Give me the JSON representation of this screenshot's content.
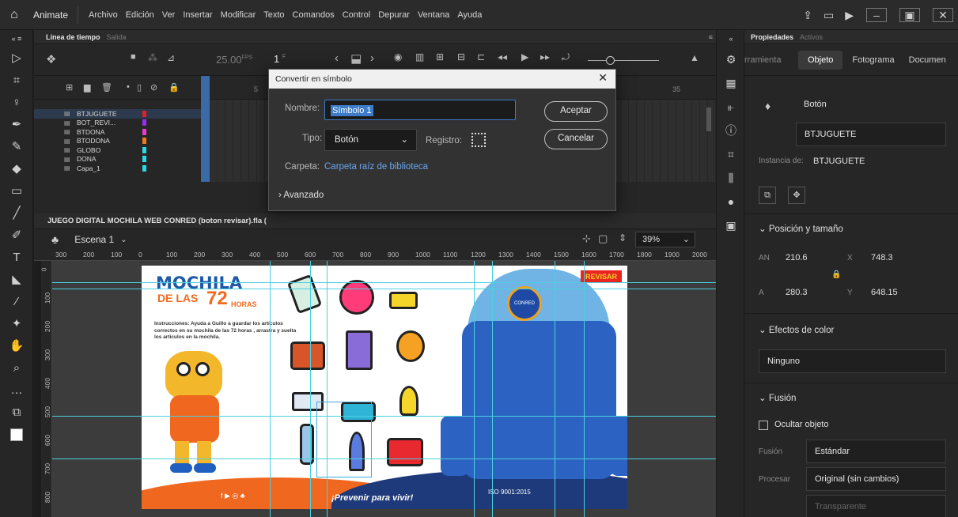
{
  "menubar": {
    "app_name": "Animate",
    "menus": [
      "Archivo",
      "Edición",
      "Ver",
      "Insertar",
      "Modificar",
      "Texto",
      "Comandos",
      "Control",
      "Depurar",
      "Ventana",
      "Ayuda"
    ]
  },
  "timeline": {
    "tabs": [
      "Línea de tiempo",
      "Salida"
    ],
    "fps": "25.00",
    "fps_unit": "FPS",
    "current_frame": "1",
    "frame_marker": "F",
    "tick_5": "5",
    "tick_35": "35",
    "layers": [
      {
        "name": "BTJUGUETE",
        "color": "#e0202a",
        "selected": true
      },
      {
        "name": "BOT_REVI...",
        "color": "#9b2cf0"
      },
      {
        "name": "BTDONA",
        "color": "#e93ad2"
      },
      {
        "name": "BTODONA",
        "color": "#f07a19"
      },
      {
        "name": "GLOBO",
        "color": "#2ad8e8"
      },
      {
        "name": "DONA",
        "color": "#2ad8e8"
      },
      {
        "name": "Capa_1",
        "color": "#2ad8e8"
      }
    ]
  },
  "document": {
    "tab_title": "JUEGO DIGITAL MOCHILA WEB CONRED (boton revisar).fla (",
    "scene": "Escena 1",
    "zoom": "39%",
    "ruler_ticks": [
      "300",
      "200",
      "100",
      "0",
      "100",
      "200",
      "300",
      "400",
      "500",
      "600",
      "700",
      "800",
      "900",
      "1000",
      "1100",
      "1200",
      "1300",
      "1400",
      "1500",
      "1600",
      "1700",
      "1800",
      "1900",
      "2000"
    ],
    "vruler_ticks": [
      "0",
      "100",
      "200",
      "300",
      "400",
      "500",
      "600",
      "700",
      "800"
    ]
  },
  "stage": {
    "title_line1": "MOCHILA",
    "title_line2": "DE LAS",
    "title_num": "72",
    "title_hours": "HORAS",
    "instructions": "Instrucciones: Ayuda a Guillo a guardar los artículos correctos en su mochila de las 72 horas , arrastra y suelta los artículos en la mochila.",
    "revisar": "REVISAR",
    "footer_slogan": "¡Prevenir para vivir!",
    "badge": "CONRED",
    "iso": "ISO 9001:2015"
  },
  "dialog": {
    "title": "Convertir en símbolo",
    "name_label": "Nombre:",
    "name_value": "Símbolo 1",
    "type_label": "Tipo:",
    "type_value": "Botón",
    "registro_label": "Registro:",
    "folder_label": "Carpeta:",
    "folder_value": "Carpeta raíz de biblioteca",
    "advanced": "Avanzado",
    "ok": "Aceptar",
    "cancel": "Cancelar"
  },
  "properties": {
    "tabs": [
      "Propiedades",
      "Activos"
    ],
    "subtabs": [
      "rramienta",
      "Objeto",
      "Fotograma",
      "Documen"
    ],
    "symbol_type": "Botón",
    "instance_name": "BTJUGUETE",
    "instance_label": "Instancia de:",
    "instance_of": "BTJUGUETE",
    "pos_section": "Posición y tamaño",
    "an_label": "AN",
    "an_value": "210.6",
    "a_label": "A",
    "a_value": "280.3",
    "x_label": "X",
    "x_value": "748.3",
    "y_label": "Y",
    "y_value": "648.15",
    "color_section": "Efectos de color",
    "color_value": "Ninguno",
    "blend_section": "Fusión",
    "hide_label": "Ocultar objeto",
    "fusion_label": "Fusión",
    "fusion_value": "Estándar",
    "process_label": "Procesar",
    "process_value": "Original (sin cambios)",
    "transparent": "Transparente"
  }
}
